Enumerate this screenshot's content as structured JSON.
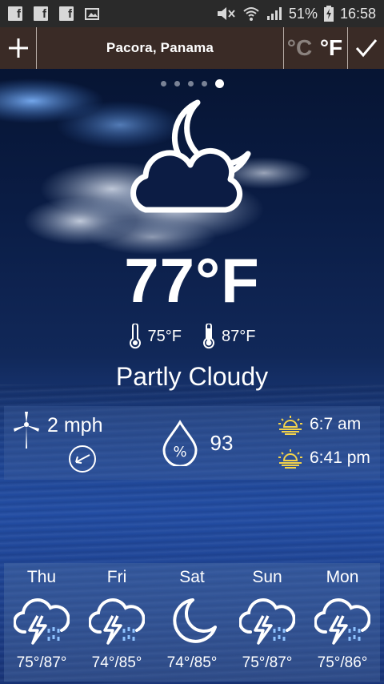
{
  "status_bar": {
    "notif_icons": [
      "facebook-icon",
      "facebook-icon",
      "facebook-icon",
      "image-notification-icon"
    ],
    "battery_pct": "51%",
    "time": "16:58"
  },
  "app_bar": {
    "location": "Pacora, Panama",
    "unit_c": "°C",
    "unit_f": "°F",
    "add_icon": "plus-icon",
    "confirm_icon": "check-icon"
  },
  "pager": {
    "count": 5,
    "active_index": 4
  },
  "current": {
    "condition_icon": "partly-cloudy-night-icon",
    "temperature": "77°F",
    "low": "75°F",
    "high": "87°F",
    "condition": "Partly Cloudy"
  },
  "details": {
    "wind_speed": "2 mph",
    "wind_icon": "wind-turbine-icon",
    "wind_direction_icon": "wind-direction-arrow-icon",
    "humidity_icon": "humidity-drop-icon",
    "humidity": "93",
    "sunrise": "6:7 am",
    "sunset": "6:41 pm"
  },
  "forecast": [
    {
      "day": "Thu",
      "icon": "thunderstorm-icon",
      "range": "75°/87°"
    },
    {
      "day": "Fri",
      "icon": "thunderstorm-icon",
      "range": "74°/85°"
    },
    {
      "day": "Sat",
      "icon": "moon-icon",
      "range": "74°/85°"
    },
    {
      "day": "Sun",
      "icon": "thunderstorm-icon",
      "range": "75°/87°"
    },
    {
      "day": "Mon",
      "icon": "thunderstorm-icon",
      "range": "75°/86°"
    }
  ]
}
